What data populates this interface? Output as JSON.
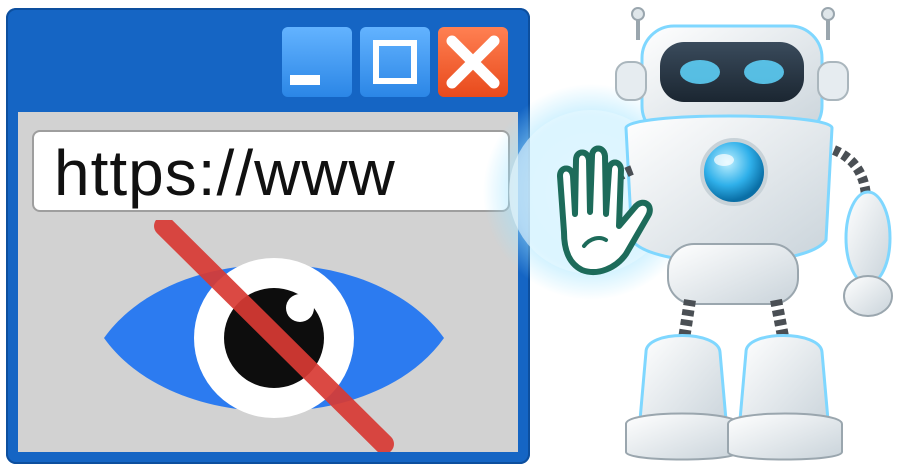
{
  "browser_window": {
    "address_bar": {
      "value": "https://www"
    },
    "controls": {
      "minimize_icon": "minimize-icon",
      "maximize_icon": "maximize-icon",
      "close_icon": "close-icon"
    },
    "content_icon": "eye-blocked-icon",
    "colors": {
      "frame": "#1565c4",
      "client_area": "#d2d2d2",
      "eye": "#2c7bf0",
      "strike": "#d83a34",
      "close_button": "#f05a28"
    }
  },
  "robot": {
    "gesture_icon": "stop-hand-icon",
    "glow_color": "#7fd7ff",
    "visor_color": "#2a3a4a"
  }
}
